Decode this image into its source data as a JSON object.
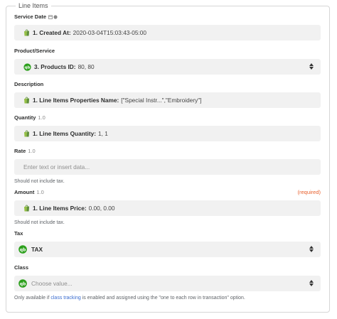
{
  "section": {
    "title": "Line Items"
  },
  "fields": {
    "service_date": {
      "label": "Service Date",
      "prefix": "1. Created At:",
      "value": "2020-03-04T15:03:43-05:00"
    },
    "product": {
      "label": "Product/Service",
      "prefix": "3. Products ID:",
      "value": "80, 80"
    },
    "description": {
      "label": "Description",
      "prefix": "1. Line Items Properties Name:",
      "value": "[\"Special Instr...\",\"Embroidery\"]"
    },
    "quantity": {
      "label": "Quantity",
      "version": "1.0",
      "prefix": "1. Line Items Quantity:",
      "value": "1, 1"
    },
    "rate": {
      "label": "Rate",
      "version": "1.0",
      "placeholder": "Enter text or insert data...",
      "help": "Should not include tax."
    },
    "amount": {
      "label": "Amount",
      "version": "1.0",
      "required": "(required)",
      "prefix": "1. Line Items Price:",
      "value": "0.00, 0.00",
      "help": "Should not include tax."
    },
    "tax": {
      "label": "Tax",
      "value": "TAX"
    },
    "class": {
      "label": "Class",
      "placeholder": "Choose value...",
      "help_before": "Only available if",
      "help_link": "class tracking",
      "help_after": "is enabled and assigned using the \"one to each row in transaction\" option."
    }
  },
  "colors": {
    "shopify_green": "#95bf47",
    "quickbooks_green": "#2ca01c",
    "required": "#e8602c",
    "link": "#3a6ccf"
  },
  "icons": {
    "shopify": "shopify-bag-icon",
    "quickbooks": "quickbooks-icon",
    "select": "updown-chevron-icon"
  }
}
